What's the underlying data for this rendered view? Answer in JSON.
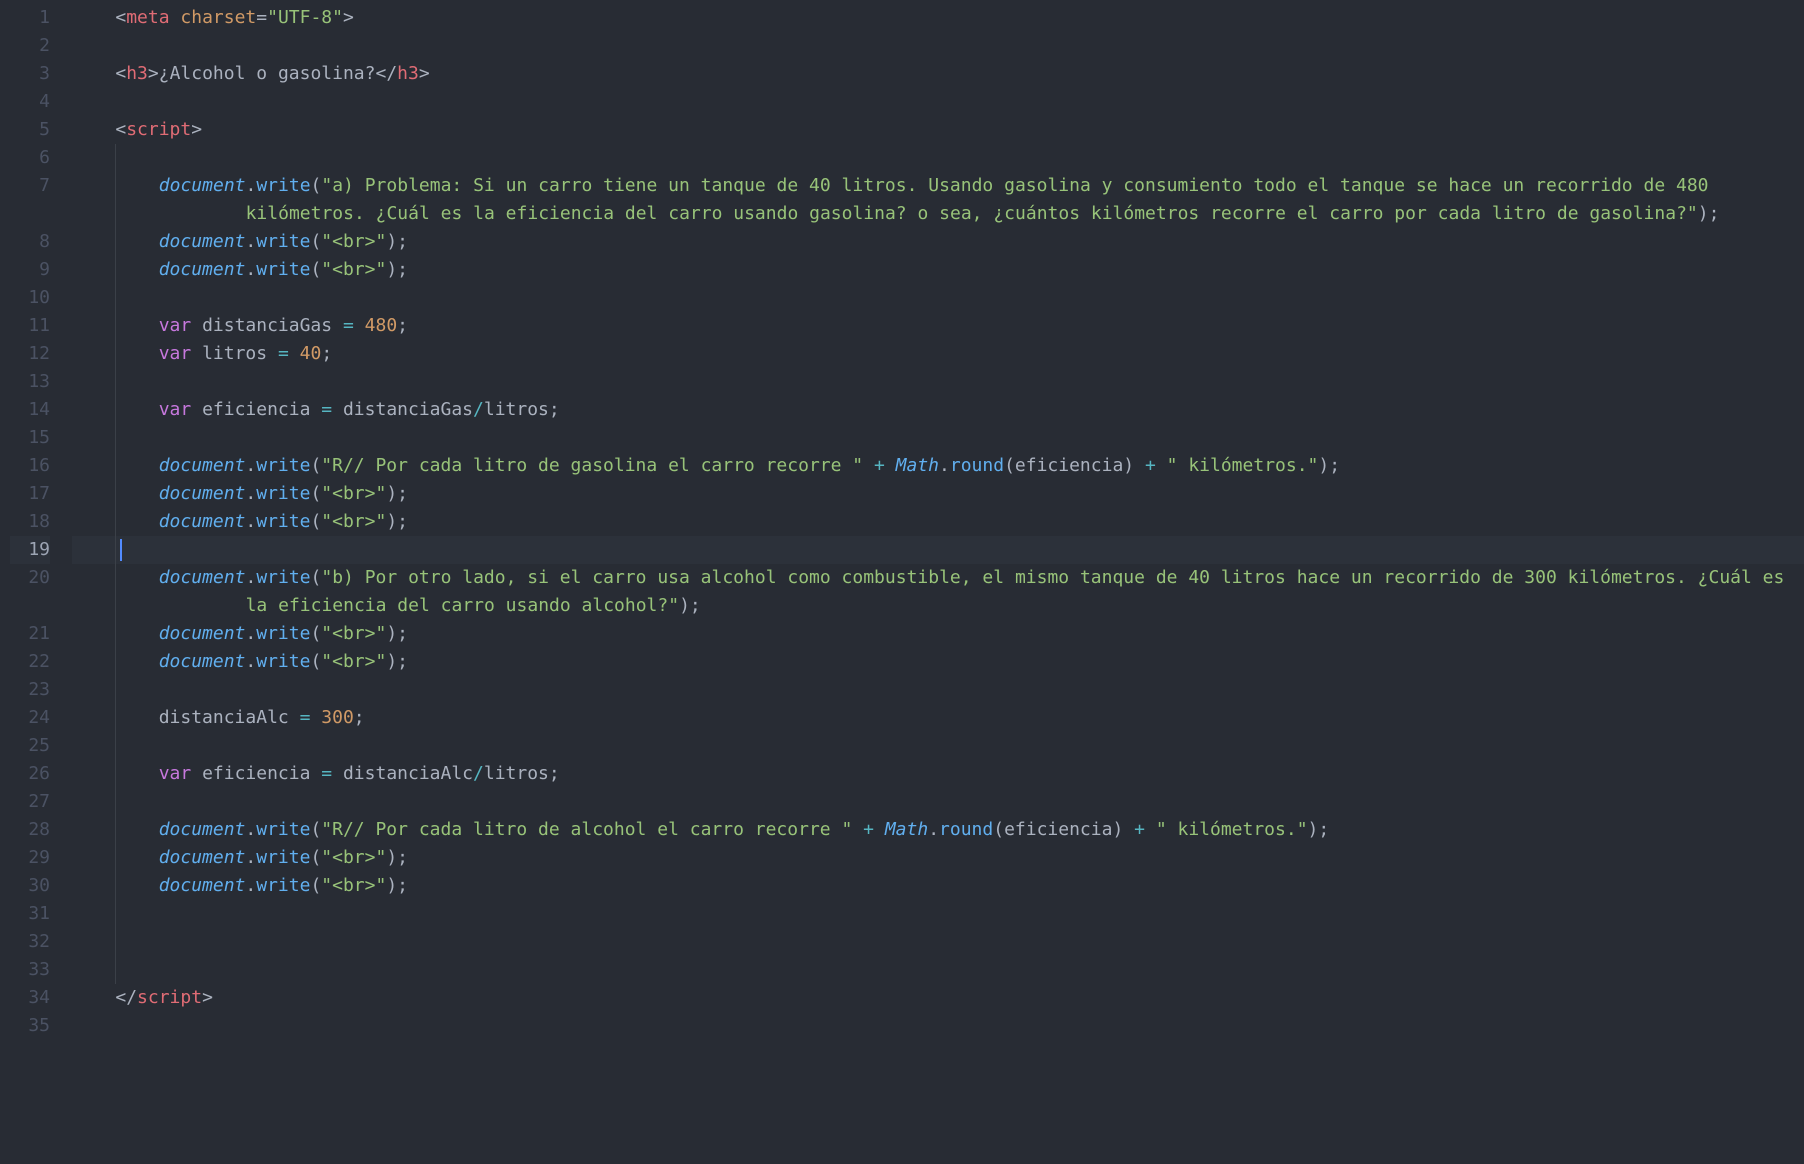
{
  "editor": {
    "line_count": 35,
    "current_line": 19,
    "indent_unit": "    ",
    "lines": {
      "1": {
        "indent": 1,
        "tokens": [
          {
            "t": "punct",
            "v": "<"
          },
          {
            "t": "tag",
            "v": "meta"
          },
          {
            "t": "plain",
            "v": " "
          },
          {
            "t": "attr",
            "v": "charset"
          },
          {
            "t": "punct",
            "v": "="
          },
          {
            "t": "str",
            "v": "\"UTF-8\""
          },
          {
            "t": "punct",
            "v": ">"
          }
        ]
      },
      "2": {
        "indent": 0,
        "tokens": []
      },
      "3": {
        "indent": 1,
        "tokens": [
          {
            "t": "punct",
            "v": "<"
          },
          {
            "t": "tag",
            "v": "h3"
          },
          {
            "t": "punct",
            "v": ">"
          },
          {
            "t": "plain",
            "v": "¿Alcohol o gasolina?"
          },
          {
            "t": "punct",
            "v": "</"
          },
          {
            "t": "tag",
            "v": "h3"
          },
          {
            "t": "punct",
            "v": ">"
          }
        ]
      },
      "4": {
        "indent": 0,
        "tokens": []
      },
      "5": {
        "indent": 1,
        "tokens": [
          {
            "t": "punct",
            "v": "<"
          },
          {
            "t": "tag",
            "v": "script"
          },
          {
            "t": "punct",
            "v": ">"
          }
        ]
      },
      "6": {
        "indent": 0,
        "tokens": []
      },
      "7": {
        "indent": 2,
        "wrap_indent": 4,
        "tokens": [
          {
            "t": "obj",
            "v": "document"
          },
          {
            "t": "punct",
            "v": "."
          },
          {
            "t": "method",
            "v": "write"
          },
          {
            "t": "punct",
            "v": "("
          },
          {
            "t": "str",
            "v": "\"a) Problema: Si un carro tiene un tanque de 40 litros. Usando gasolina y consumiento todo el tanque se hace un recorrido de 480 kilómetros. ¿Cuál es la eficiencia del carro usando gasolina? o sea, ¿cuántos kilómetros recorre el carro por cada litro de gasolina?\""
          },
          {
            "t": "punct",
            "v": ");"
          }
        ]
      },
      "8": {
        "indent": 2,
        "tokens": [
          {
            "t": "obj",
            "v": "document"
          },
          {
            "t": "punct",
            "v": "."
          },
          {
            "t": "method",
            "v": "write"
          },
          {
            "t": "punct",
            "v": "("
          },
          {
            "t": "str",
            "v": "\"<br>\""
          },
          {
            "t": "punct",
            "v": ");"
          }
        ]
      },
      "9": {
        "indent": 2,
        "tokens": [
          {
            "t": "obj",
            "v": "document"
          },
          {
            "t": "punct",
            "v": "."
          },
          {
            "t": "method",
            "v": "write"
          },
          {
            "t": "punct",
            "v": "("
          },
          {
            "t": "str",
            "v": "\"<br>\""
          },
          {
            "t": "punct",
            "v": ");"
          }
        ]
      },
      "10": {
        "indent": 0,
        "tokens": []
      },
      "11": {
        "indent": 2,
        "tokens": [
          {
            "t": "kw",
            "v": "var"
          },
          {
            "t": "plain",
            "v": " "
          },
          {
            "t": "plain",
            "v": "distanciaGas"
          },
          {
            "t": "plain",
            "v": " "
          },
          {
            "t": "op",
            "v": "="
          },
          {
            "t": "plain",
            "v": " "
          },
          {
            "t": "num",
            "v": "480"
          },
          {
            "t": "punct",
            "v": ";"
          }
        ]
      },
      "12": {
        "indent": 2,
        "tokens": [
          {
            "t": "kw",
            "v": "var"
          },
          {
            "t": "plain",
            "v": " "
          },
          {
            "t": "plain",
            "v": "litros"
          },
          {
            "t": "plain",
            "v": " "
          },
          {
            "t": "op",
            "v": "="
          },
          {
            "t": "plain",
            "v": " "
          },
          {
            "t": "num",
            "v": "40"
          },
          {
            "t": "punct",
            "v": ";"
          }
        ]
      },
      "13": {
        "indent": 0,
        "tokens": []
      },
      "14": {
        "indent": 2,
        "tokens": [
          {
            "t": "kw",
            "v": "var"
          },
          {
            "t": "plain",
            "v": " "
          },
          {
            "t": "plain",
            "v": "eficiencia"
          },
          {
            "t": "plain",
            "v": " "
          },
          {
            "t": "op",
            "v": "="
          },
          {
            "t": "plain",
            "v": " "
          },
          {
            "t": "plain",
            "v": "distanciaGas"
          },
          {
            "t": "op",
            "v": "/"
          },
          {
            "t": "plain",
            "v": "litros"
          },
          {
            "t": "punct",
            "v": ";"
          }
        ]
      },
      "15": {
        "indent": 0,
        "tokens": []
      },
      "16": {
        "indent": 2,
        "tokens": [
          {
            "t": "obj",
            "v": "document"
          },
          {
            "t": "punct",
            "v": "."
          },
          {
            "t": "method",
            "v": "write"
          },
          {
            "t": "punct",
            "v": "("
          },
          {
            "t": "str",
            "v": "\"R// Por cada litro de gasolina el carro recorre \""
          },
          {
            "t": "plain",
            "v": " "
          },
          {
            "t": "op",
            "v": "+"
          },
          {
            "t": "plain",
            "v": " "
          },
          {
            "t": "builtin",
            "v": "Math"
          },
          {
            "t": "punct",
            "v": "."
          },
          {
            "t": "method",
            "v": "round"
          },
          {
            "t": "punct",
            "v": "("
          },
          {
            "t": "plain",
            "v": "eficiencia"
          },
          {
            "t": "punct",
            "v": ")"
          },
          {
            "t": "plain",
            "v": " "
          },
          {
            "t": "op",
            "v": "+"
          },
          {
            "t": "plain",
            "v": " "
          },
          {
            "t": "str",
            "v": "\" kilómetros.\""
          },
          {
            "t": "punct",
            "v": ");"
          }
        ]
      },
      "17": {
        "indent": 2,
        "tokens": [
          {
            "t": "obj",
            "v": "document"
          },
          {
            "t": "punct",
            "v": "."
          },
          {
            "t": "method",
            "v": "write"
          },
          {
            "t": "punct",
            "v": "("
          },
          {
            "t": "str",
            "v": "\"<br>\""
          },
          {
            "t": "punct",
            "v": ");"
          }
        ]
      },
      "18": {
        "indent": 2,
        "tokens": [
          {
            "t": "obj",
            "v": "document"
          },
          {
            "t": "punct",
            "v": "."
          },
          {
            "t": "method",
            "v": "write"
          },
          {
            "t": "punct",
            "v": "("
          },
          {
            "t": "str",
            "v": "\"<br>\""
          },
          {
            "t": "punct",
            "v": ");"
          }
        ]
      },
      "19": {
        "indent": 2,
        "tokens": []
      },
      "20": {
        "indent": 2,
        "wrap_indent": 4,
        "tokens": [
          {
            "t": "obj",
            "v": "document"
          },
          {
            "t": "punct",
            "v": "."
          },
          {
            "t": "method",
            "v": "write"
          },
          {
            "t": "punct",
            "v": "("
          },
          {
            "t": "str",
            "v": "\"b) Por otro lado, si el carro usa alcohol como combustible, el mismo tanque de 40 litros hace un recorrido de 300 kilómetros. ¿Cuál es la eficiencia del carro usando alcohol?\""
          },
          {
            "t": "punct",
            "v": ");"
          }
        ]
      },
      "21": {
        "indent": 2,
        "tokens": [
          {
            "t": "obj",
            "v": "document"
          },
          {
            "t": "punct",
            "v": "."
          },
          {
            "t": "method",
            "v": "write"
          },
          {
            "t": "punct",
            "v": "("
          },
          {
            "t": "str",
            "v": "\"<br>\""
          },
          {
            "t": "punct",
            "v": ");"
          }
        ]
      },
      "22": {
        "indent": 2,
        "tokens": [
          {
            "t": "obj",
            "v": "document"
          },
          {
            "t": "punct",
            "v": "."
          },
          {
            "t": "method",
            "v": "write"
          },
          {
            "t": "punct",
            "v": "("
          },
          {
            "t": "str",
            "v": "\"<br>\""
          },
          {
            "t": "punct",
            "v": ");"
          }
        ]
      },
      "23": {
        "indent": 0,
        "tokens": []
      },
      "24": {
        "indent": 2,
        "tokens": [
          {
            "t": "plain",
            "v": "distanciaAlc"
          },
          {
            "t": "plain",
            "v": " "
          },
          {
            "t": "op",
            "v": "="
          },
          {
            "t": "plain",
            "v": " "
          },
          {
            "t": "num",
            "v": "300"
          },
          {
            "t": "punct",
            "v": ";"
          }
        ]
      },
      "25": {
        "indent": 0,
        "tokens": []
      },
      "26": {
        "indent": 2,
        "tokens": [
          {
            "t": "kw",
            "v": "var"
          },
          {
            "t": "plain",
            "v": " "
          },
          {
            "t": "plain",
            "v": "eficiencia"
          },
          {
            "t": "plain",
            "v": " "
          },
          {
            "t": "op",
            "v": "="
          },
          {
            "t": "plain",
            "v": " "
          },
          {
            "t": "plain",
            "v": "distanciaAlc"
          },
          {
            "t": "op",
            "v": "/"
          },
          {
            "t": "plain",
            "v": "litros"
          },
          {
            "t": "punct",
            "v": ";"
          }
        ]
      },
      "27": {
        "indent": 0,
        "tokens": []
      },
      "28": {
        "indent": 2,
        "tokens": [
          {
            "t": "obj",
            "v": "document"
          },
          {
            "t": "punct",
            "v": "."
          },
          {
            "t": "method",
            "v": "write"
          },
          {
            "t": "punct",
            "v": "("
          },
          {
            "t": "str",
            "v": "\"R// Por cada litro de alcohol el carro recorre \""
          },
          {
            "t": "plain",
            "v": " "
          },
          {
            "t": "op",
            "v": "+"
          },
          {
            "t": "plain",
            "v": " "
          },
          {
            "t": "builtin",
            "v": "Math"
          },
          {
            "t": "punct",
            "v": "."
          },
          {
            "t": "method",
            "v": "round"
          },
          {
            "t": "punct",
            "v": "("
          },
          {
            "t": "plain",
            "v": "eficiencia"
          },
          {
            "t": "punct",
            "v": ")"
          },
          {
            "t": "plain",
            "v": " "
          },
          {
            "t": "op",
            "v": "+"
          },
          {
            "t": "plain",
            "v": " "
          },
          {
            "t": "str",
            "v": "\" kilómetros.\""
          },
          {
            "t": "punct",
            "v": ");"
          }
        ]
      },
      "29": {
        "indent": 2,
        "tokens": [
          {
            "t": "obj",
            "v": "document"
          },
          {
            "t": "punct",
            "v": "."
          },
          {
            "t": "method",
            "v": "write"
          },
          {
            "t": "punct",
            "v": "("
          },
          {
            "t": "str",
            "v": "\"<br>\""
          },
          {
            "t": "punct",
            "v": ");"
          }
        ]
      },
      "30": {
        "indent": 2,
        "tokens": [
          {
            "t": "obj",
            "v": "document"
          },
          {
            "t": "punct",
            "v": "."
          },
          {
            "t": "method",
            "v": "write"
          },
          {
            "t": "punct",
            "v": "("
          },
          {
            "t": "str",
            "v": "\"<br>\""
          },
          {
            "t": "punct",
            "v": ");"
          }
        ]
      },
      "31": {
        "indent": 0,
        "tokens": []
      },
      "32": {
        "indent": 0,
        "tokens": []
      },
      "33": {
        "indent": 0,
        "tokens": []
      },
      "34": {
        "indent": 1,
        "tokens": [
          {
            "t": "punct",
            "v": "</"
          },
          {
            "t": "tag",
            "v": "script"
          },
          {
            "t": "punct",
            "v": ">"
          }
        ]
      },
      "35": {
        "indent": 0,
        "tokens": []
      }
    }
  }
}
